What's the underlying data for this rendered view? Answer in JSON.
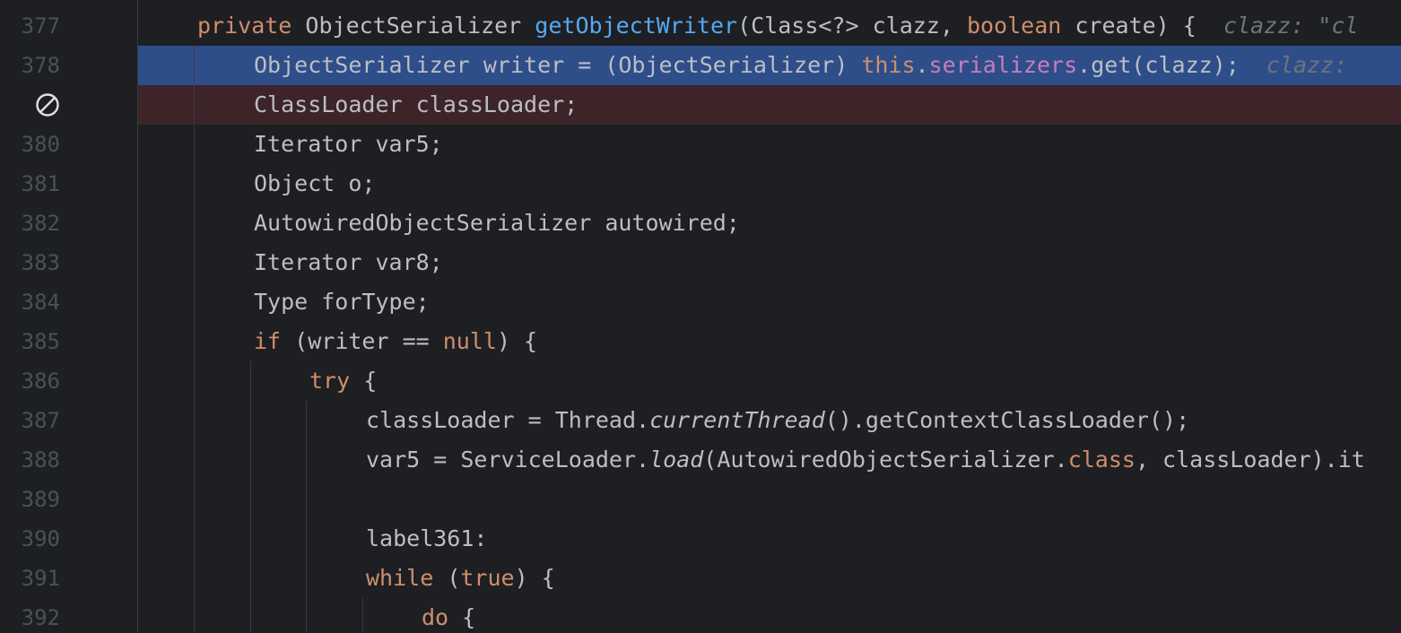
{
  "editor": {
    "breakpoint_icon": "disabled-breakpoint-icon",
    "colors": {
      "background": "#1e1f22",
      "execution_line": "#2e4e8a",
      "breakpoint_line": "#3c2429",
      "keyword": "#cf8e6d",
      "method": "#56a8f5",
      "field": "#c77dbb",
      "text": "#bcbec4",
      "line_number": "#4b5059"
    },
    "lines": [
      {
        "number": "377",
        "t1": "private",
        "t2": " ObjectSerializer ",
        "t3": "getObjectWriter",
        "t4": "(Class<?> clazz, ",
        "t5": "boolean",
        "t6": " create) {",
        "hint": "clazz: \"cl"
      },
      {
        "number": "378",
        "t1": "ObjectSerializer writer = (ObjectSerializer) ",
        "t2": "this",
        "t3": ".",
        "t4": "serializers",
        "t5": ".get(clazz);",
        "hint": "clazz: "
      },
      {
        "number": "",
        "text": "ClassLoader classLoader;"
      },
      {
        "number": "380",
        "text": "Iterator var5;"
      },
      {
        "number": "381",
        "text": "Object o;"
      },
      {
        "number": "382",
        "text": "AutowiredObjectSerializer autowired;"
      },
      {
        "number": "383",
        "text": "Iterator var8;"
      },
      {
        "number": "384",
        "text": "Type forType;"
      },
      {
        "number": "385",
        "t1": "if",
        "t2": " (writer == ",
        "t3": "null",
        "t4": ") {"
      },
      {
        "number": "386",
        "t1": "try",
        "t2": " {"
      },
      {
        "number": "387",
        "t1": "classLoader = Thread.",
        "t2": "currentThread",
        "t3": "().getContextClassLoader();"
      },
      {
        "number": "388",
        "t1": "var5 = ServiceLoader.",
        "t2": "load",
        "t3": "(AutowiredObjectSerializer.",
        "t4": "class",
        "t5": ", classLoader).it"
      },
      {
        "number": "389",
        "text": ""
      },
      {
        "number": "390",
        "text": "label361:"
      },
      {
        "number": "391",
        "t1": "while",
        "t2": " (",
        "t3": "true",
        "t4": ") {"
      },
      {
        "number": "392",
        "t1": "do",
        "t2": " {"
      }
    ]
  }
}
